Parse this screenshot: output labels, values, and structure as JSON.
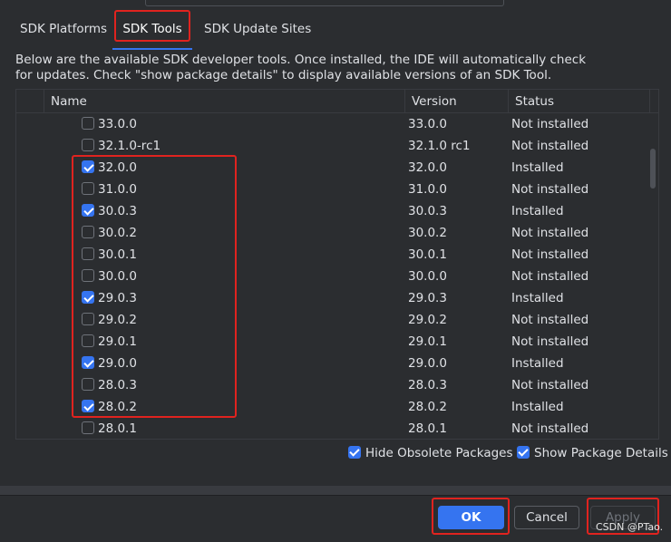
{
  "tabs": [
    {
      "label": "SDK Platforms",
      "selected": false
    },
    {
      "label": "SDK Tools",
      "selected": true
    },
    {
      "label": "SDK Update Sites",
      "selected": false
    }
  ],
  "description": {
    "line1": "Below are the available SDK developer tools. Once installed, the IDE will automatically check",
    "line2": "for updates. Check \"show package details\" to display available versions of an SDK Tool."
  },
  "table": {
    "columns": {
      "name": "Name",
      "version": "Version",
      "status": "Status"
    },
    "rows": [
      {
        "name": "33.0.0",
        "version": "33.0.0",
        "status": "Not installed",
        "checked": false
      },
      {
        "name": "32.1.0-rc1",
        "version": "32.1.0 rc1",
        "status": "Not installed",
        "checked": false
      },
      {
        "name": "32.0.0",
        "version": "32.0.0",
        "status": "Installed",
        "checked": true
      },
      {
        "name": "31.0.0",
        "version": "31.0.0",
        "status": "Not installed",
        "checked": false
      },
      {
        "name": "30.0.3",
        "version": "30.0.3",
        "status": "Installed",
        "checked": true
      },
      {
        "name": "30.0.2",
        "version": "30.0.2",
        "status": "Not installed",
        "checked": false
      },
      {
        "name": "30.0.1",
        "version": "30.0.1",
        "status": "Not installed",
        "checked": false
      },
      {
        "name": "30.0.0",
        "version": "30.0.0",
        "status": "Not installed",
        "checked": false
      },
      {
        "name": "29.0.3",
        "version": "29.0.3",
        "status": "Installed",
        "checked": true
      },
      {
        "name": "29.0.2",
        "version": "29.0.2",
        "status": "Not installed",
        "checked": false
      },
      {
        "name": "29.0.1",
        "version": "29.0.1",
        "status": "Not installed",
        "checked": false
      },
      {
        "name": "29.0.0",
        "version": "29.0.0",
        "status": "Installed",
        "checked": true
      },
      {
        "name": "28.0.3",
        "version": "28.0.3",
        "status": "Not installed",
        "checked": false
      },
      {
        "name": "28.0.2",
        "version": "28.0.2",
        "status": "Installed",
        "checked": true
      },
      {
        "name": "28.0.1",
        "version": "28.0.1",
        "status": "Not installed",
        "checked": false
      }
    ]
  },
  "options": {
    "hide_obsolete": {
      "label": "Hide Obsolete Packages",
      "checked": true
    },
    "show_details": {
      "label": "Show Package Details",
      "checked": true
    }
  },
  "buttons": {
    "ok": "OK",
    "cancel": "Cancel",
    "apply": "Apply"
  },
  "watermark": "CSDN @PTao.",
  "colors": {
    "accent": "#3574f0",
    "highlight": "#e0231f",
    "background": "#2b2d30"
  }
}
